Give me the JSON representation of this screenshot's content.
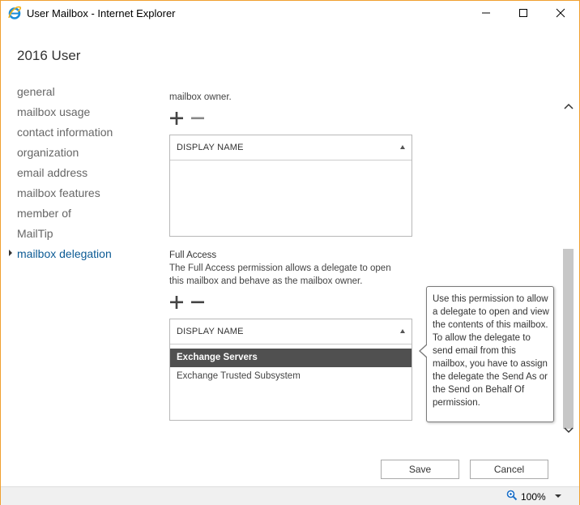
{
  "window": {
    "title": "User Mailbox - Internet Explorer",
    "accent_color": "#f0a030"
  },
  "page": {
    "title": "2016 User"
  },
  "nav": {
    "items": [
      {
        "label": "general",
        "active": false
      },
      {
        "label": "mailbox usage",
        "active": false
      },
      {
        "label": "contact information",
        "active": false
      },
      {
        "label": "organization",
        "active": false
      },
      {
        "label": "email address",
        "active": false
      },
      {
        "label": "mailbox features",
        "active": false
      },
      {
        "label": "member of",
        "active": false
      },
      {
        "label": "MailTip",
        "active": false
      },
      {
        "label": "mailbox delegation",
        "active": true
      }
    ],
    "active_color": "#0b5a94"
  },
  "send_on_behalf": {
    "trailing_text": "mailbox owner.",
    "list": {
      "column_header": "DISPLAY NAME",
      "rows": []
    }
  },
  "full_access": {
    "heading": "Full Access",
    "description": "The Full Access permission allows a delegate to open this mailbox and behave as the mailbox owner.",
    "list": {
      "column_header": "DISPLAY NAME",
      "rows": [
        {
          "name": "Exchange Servers",
          "selected": true
        },
        {
          "name": "Exchange Trusted Subsystem",
          "selected": false
        }
      ]
    }
  },
  "tooltip": {
    "text": "Use this permission to allow a delegate to open and view the contents of this mailbox. To allow the delegate to send email from this mailbox, you have to assign the delegate the Send As or the Send on Behalf Of permission."
  },
  "buttons": {
    "save": "Save",
    "cancel": "Cancel"
  },
  "statusbar": {
    "zoom": "100%"
  },
  "icons": {
    "browser": "internet-explorer-icon",
    "add": "plus-icon",
    "remove": "minus-icon",
    "zoom": "magnifier-icon"
  }
}
